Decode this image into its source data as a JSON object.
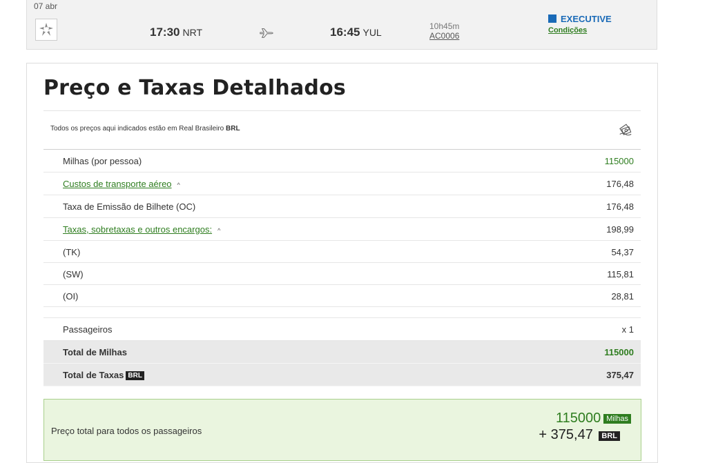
{
  "flight": {
    "date": "07 abr",
    "dep_time": "17:30",
    "dep_code": "NRT",
    "arr_time": "16:45",
    "arr_code": "YUL",
    "duration": "10h45m",
    "flight_number": "AC0006",
    "cabin": "EXECUTIVE",
    "conditions": "Condições",
    "icons": {
      "airline": "star-alliance-logo",
      "plane": "plane-icon",
      "cabin": "executive-cabin-icon"
    }
  },
  "prices": {
    "title": "Preço e Taxas Detalhados",
    "note_prefix": "Todos os preços aqui indicados estão em Real Brasileiro",
    "note_currency": "BRL",
    "money_icon": "money-icon",
    "rows": [
      {
        "label": "Milhas (por pessoa)",
        "value": "115000"
      },
      {
        "label": "Custos de transporte aéreo",
        "value": "176,48"
      },
      {
        "label": "Taxa de Emissão de Bilhete (OC)",
        "value": "176,48"
      },
      {
        "label": "Taxas, sobretaxas e outros encargos:",
        "value": "198,99"
      },
      {
        "label": "(TK)",
        "value": "54,37"
      },
      {
        "label": "(SW)",
        "value": "115,81"
      },
      {
        "label": "(OI)",
        "value": "28,81"
      },
      {
        "label": "Passageiros",
        "value": "x 1"
      }
    ],
    "caret": "^",
    "total_miles_label": "Total de Milhas",
    "total_miles_value": "115000",
    "total_taxes_label": "Total de Taxas",
    "total_taxes_currency": "BRL",
    "total_taxes_value": "375,47",
    "grand_label": "Preço total para todos os passageiros",
    "grand_miles": "115000",
    "grand_miles_unit": "Milhas",
    "grand_cash": "+ 375,47",
    "grand_cash_currency": "BRL"
  },
  "colors": {
    "accent_green": "#2e7d1f",
    "cabin_blue": "#1a6ab7",
    "grand_bg": "#eaf5df"
  }
}
